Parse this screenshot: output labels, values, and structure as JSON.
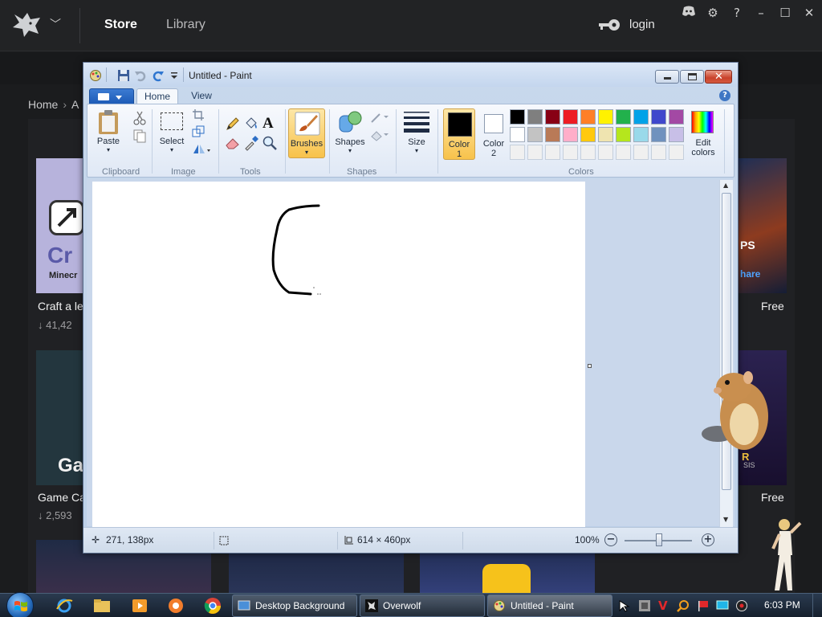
{
  "overwolf": {
    "nav": {
      "store": "Store",
      "library": "Library"
    },
    "login": "login",
    "breadcrumb": {
      "home": "Home",
      "sep": "›",
      "next": "A"
    },
    "cards": [
      {
        "word": "Cr",
        "sub": "Minecr",
        "title": "Craft a le",
        "downloads": "↓ 41,42"
      },
      {
        "word": "Ga",
        "title": "Game Ca",
        "downloads": "↓ 2,593"
      },
      {
        "ps": "PS",
        "share": "hare",
        "price": "Free"
      },
      {
        "r": "R",
        "sis": "SIS",
        "price": "Free"
      }
    ],
    "icons": [
      "overwolf-logo-icon",
      "chevron-down-icon",
      "key-icon",
      "discord-icon",
      "gear-icon",
      "help-icon",
      "minimize-icon",
      "maximize-icon",
      "close-icon"
    ]
  },
  "paint": {
    "title": "Untitled - Paint",
    "tabs": {
      "home": "Home",
      "view": "View"
    },
    "help": "?",
    "groups": {
      "clipboard": "Clipboard",
      "image": "Image",
      "tools": "Tools",
      "shapes": "Shapes",
      "colors": "Colors"
    },
    "buttons": {
      "paste": "Paste",
      "select": "Select",
      "brushes": "Brushes",
      "shapes": "Shapes",
      "size": "Size",
      "color1": "Color\n1",
      "color1_line1": "Color",
      "color1_line2": "1",
      "color2_line1": "Color",
      "color2_line2": "2",
      "edit_colors_line1": "Edit",
      "edit_colors_line2": "colors"
    },
    "palette_row1": [
      "#000000",
      "#7f7f7f",
      "#880015",
      "#ed1c24",
      "#ff7f27",
      "#fff200",
      "#22b14c",
      "#00a2e8",
      "#3f48cc",
      "#a349a4"
    ],
    "palette_row2": [
      "#ffffff",
      "#c3c3c3",
      "#b97a57",
      "#ffaec9",
      "#ffc90e",
      "#efe4b0",
      "#b5e61d",
      "#99d9ea",
      "#7092be",
      "#c8bfe7"
    ],
    "palette_row3": [
      "#f0f0f0",
      "#f0f0f0",
      "#f0f0f0",
      "#f0f0f0",
      "#f0f0f0",
      "#f0f0f0",
      "#f0f0f0",
      "#f0f0f0",
      "#f0f0f0",
      "#f0f0f0"
    ],
    "color1": "#000000",
    "color2": "#ffffff",
    "status": {
      "cursor_pos": "271, 138px",
      "canvas_size": "614 × 460px",
      "zoom": "100%"
    }
  },
  "taskbar": {
    "tasks": [
      {
        "label": "Desktop Background"
      },
      {
        "label": "Overwolf"
      },
      {
        "label": "Untitled - Paint"
      }
    ],
    "clock": "6:03 PM"
  }
}
